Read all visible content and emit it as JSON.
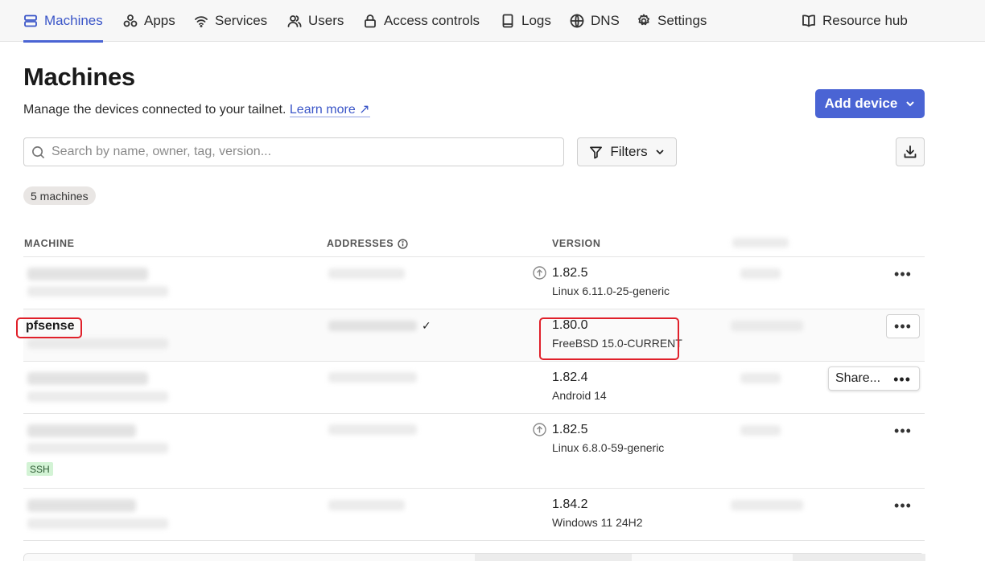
{
  "nav": {
    "items": [
      {
        "label": "Machines",
        "icon": "machines-icon"
      },
      {
        "label": "Apps",
        "icon": "apps-icon"
      },
      {
        "label": "Services",
        "icon": "wifi-icon"
      },
      {
        "label": "Users",
        "icon": "users-icon"
      },
      {
        "label": "Access controls",
        "icon": "lock-icon"
      },
      {
        "label": "Logs",
        "icon": "logs-icon"
      },
      {
        "label": "DNS",
        "icon": "globe-icon"
      },
      {
        "label": "Settings",
        "icon": "gear-icon"
      }
    ],
    "resource_hub": "Resource hub",
    "active": "Machines",
    "accent": "#4a64d4"
  },
  "header": {
    "title": "Machines",
    "description": "Manage the devices connected to your tailnet.",
    "learn_more": "Learn more ↗",
    "add_device": "Add device"
  },
  "search": {
    "placeholder": "Search by name, owner, tag, version..."
  },
  "filters_label": "Filters",
  "count_label": "5 machines",
  "table": {
    "columns": [
      "MACHINE",
      "ADDRESSES",
      "VERSION"
    ],
    "rows": [
      {
        "name": "",
        "version": "1.82.5",
        "os": "Linux 6.11.0-25-generic",
        "update_available": true
      },
      {
        "name": "pfsense",
        "version": "1.80.0",
        "os": "FreeBSD 15.0-CURRENT",
        "update_available": false,
        "highlighted": true
      },
      {
        "name": "",
        "version": "1.82.4",
        "os": "Android 14",
        "update_available": false
      },
      {
        "name": "",
        "version": "1.82.5",
        "os": "Linux 6.8.0-59-generic",
        "update_available": true,
        "tag": "SSH"
      },
      {
        "name": "",
        "version": "1.84.2",
        "os": "Windows 11 24H2",
        "update_available": false
      }
    ]
  },
  "share_label": "Share...",
  "more_label": "•••",
  "highlight_color": "#e0202a"
}
